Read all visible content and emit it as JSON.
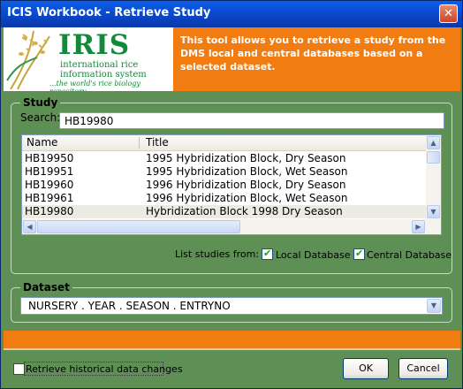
{
  "window": {
    "title": "ICIS Workbook - Retrieve Study",
    "close_glyph": "✕"
  },
  "banner": {
    "logo_main": "IRIS",
    "logo_line1": "international rice",
    "logo_line2": "information system",
    "logo_tagline": "...the world's rice biology repository",
    "description": "This tool allows you to retrieve a study from the DMS local and central databases based on a selected dataset."
  },
  "study": {
    "group_label": "Study",
    "search_label": "Search:",
    "search_value": "HB19980",
    "columns": [
      "Name",
      "Title"
    ],
    "rows": [
      {
        "name": "HB19950",
        "title": "1995 Hybridization Block,  Dry Season"
      },
      {
        "name": "HB19951",
        "title": "1995 Hybridization Block,  Wet Season"
      },
      {
        "name": "HB19960",
        "title": "1996 Hybridization Block,  Dry Season"
      },
      {
        "name": "HB19961",
        "title": "1996 Hybridization Block,  Wet Season"
      },
      {
        "name": "HB19980",
        "title": "Hybridization Block 1998 Dry Season"
      }
    ],
    "selected_index": 4,
    "list_from_label": "List studies from:",
    "local_db_label": "Local Database",
    "local_db_checked": true,
    "central_db_label": "Central Database",
    "central_db_checked": true
  },
  "dataset": {
    "group_label": "Dataset",
    "selected": "NURSERY . YEAR . SEASON . ENTRYNO"
  },
  "footer": {
    "history_label": "Retrieve historical data changes",
    "history_checked": false,
    "ok_label": "OK",
    "cancel_label": "Cancel"
  },
  "icons": {
    "close": "close-icon",
    "check": "checkmark-icon",
    "up": "scroll-up-icon",
    "down": "scroll-down-icon",
    "left": "scroll-left-icon",
    "right": "scroll-right-icon",
    "dropdown": "dropdown-arrow-icon"
  },
  "colors": {
    "titlebar": "#0a47c9",
    "banner_orange": "#f07c12",
    "dialog_green": "#5e8f55",
    "logo_green": "#138a3a"
  }
}
